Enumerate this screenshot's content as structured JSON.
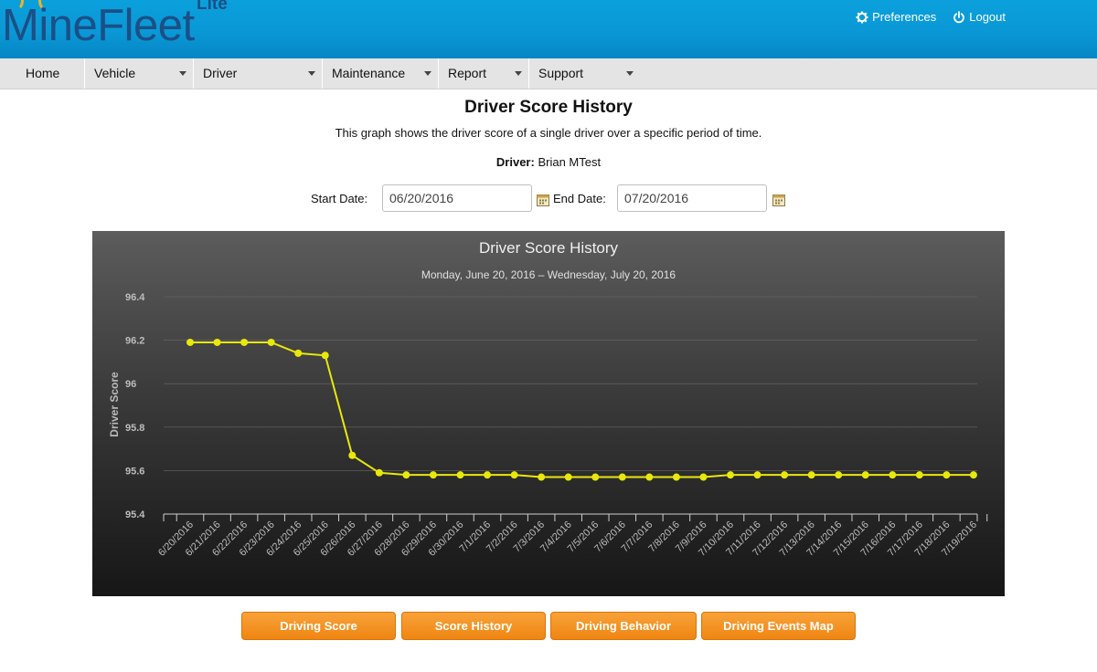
{
  "header": {
    "logo_text": "MineFleet",
    "logo_sub": "Lite",
    "preferences_label": "Preferences",
    "logout_label": "Logout"
  },
  "menu": {
    "items": [
      {
        "label": "Home"
      },
      {
        "label": "Vehicle"
      },
      {
        "label": "Driver"
      },
      {
        "label": "Maintenance"
      },
      {
        "label": "Report"
      },
      {
        "label": "Support"
      }
    ]
  },
  "page": {
    "title": "Driver Score History",
    "description": "This graph shows the driver score of a single driver over a specific period of time.",
    "driver_label": "Driver:",
    "driver_name": "Brian MTest",
    "start_label": "Start Date:",
    "start_value": "06/20/2016",
    "end_label": "End Date:",
    "end_value": "07/20/2016"
  },
  "chart_data": {
    "type": "line",
    "title": "Driver Score History",
    "subtitle": "Monday, June 20, 2016 – Wednesday, July 20, 2016",
    "ylabel": "Driver Score",
    "xlabel": "",
    "ylim": [
      95.4,
      96.4
    ],
    "yticks": [
      "95.4",
      "95.6",
      "95.8",
      "96",
      "96.2",
      "96.4"
    ],
    "grid": true,
    "line_color": "#e8e80c",
    "categories": [
      "6/20/2016",
      "6/21/2016",
      "6/22/2016",
      "6/23/2016",
      "6/24/2016",
      "6/25/2016",
      "6/26/2016",
      "6/27/2016",
      "6/28/2016",
      "6/29/2016",
      "6/30/2016",
      "7/1/2016",
      "7/2/2016",
      "7/3/2016",
      "7/4/2016",
      "7/5/2016",
      "7/6/2016",
      "7/7/2016",
      "7/8/2016",
      "7/9/2016",
      "7/10/2016",
      "7/11/2016",
      "7/12/2016",
      "7/13/2016",
      "7/14/2016",
      "7/15/2016",
      "7/16/2016",
      "7/17/2016",
      "7/18/2016",
      "7/19/2016"
    ],
    "values": [
      96.19,
      96.19,
      96.19,
      96.19,
      96.14,
      96.13,
      95.67,
      95.59,
      95.58,
      95.58,
      95.58,
      95.58,
      95.58,
      95.57,
      95.57,
      95.57,
      95.57,
      95.57,
      95.57,
      95.57,
      95.58,
      95.58,
      95.58,
      95.58,
      95.58,
      95.58,
      95.58,
      95.58,
      95.58,
      95.58
    ]
  },
  "buttons": {
    "driving_score": "Driving Score",
    "score_history": "Score History",
    "driving_behavior": "Driving Behavior",
    "driving_events_map": "Driving Events Map"
  },
  "colors": {
    "header_blue": "#0aa0dc",
    "logo_blue": "#1b4f86",
    "button_orange": "#f39324"
  }
}
